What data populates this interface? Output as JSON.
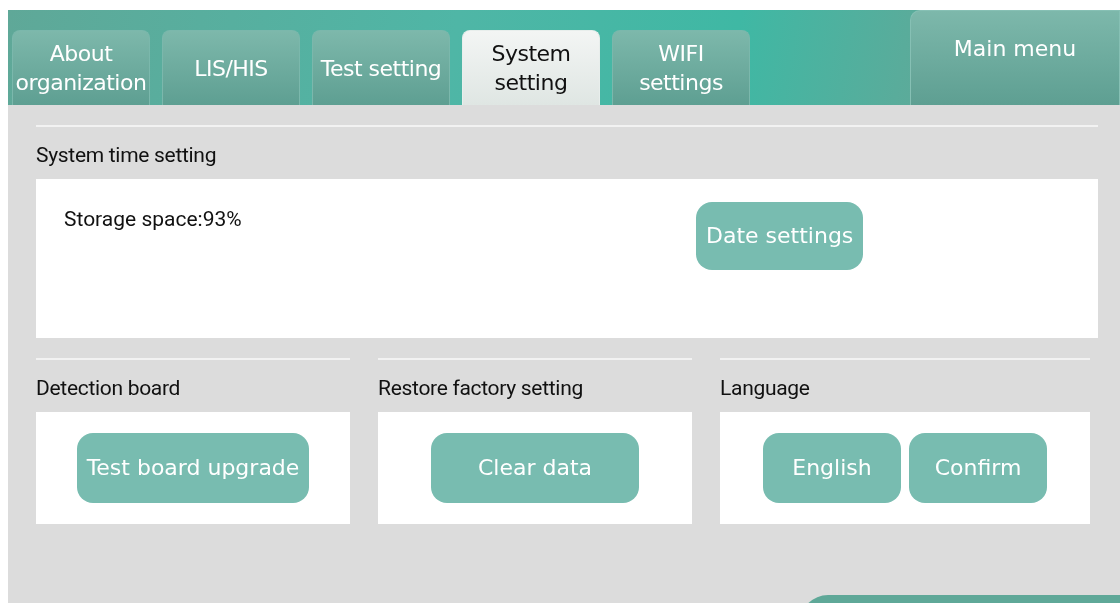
{
  "tabs": [
    {
      "label": "About organization",
      "selected": false
    },
    {
      "label": "LIS/HIS",
      "selected": false
    },
    {
      "label": "Test setting",
      "selected": false
    },
    {
      "label": "System setting",
      "selected": true
    },
    {
      "label": "WIFI settings",
      "selected": false
    }
  ],
  "main_menu": "Main menu",
  "time_section": {
    "title": "System time setting",
    "storage": "Storage space:93%",
    "button": "Date settings"
  },
  "sections": [
    {
      "title": "Detection board",
      "buttons": [
        "Test board upgrade"
      ]
    },
    {
      "title": "Restore factory setting",
      "buttons": [
        "Clear data"
      ]
    },
    {
      "title": "Language",
      "buttons": [
        "English",
        "Confirm"
      ]
    }
  ]
}
